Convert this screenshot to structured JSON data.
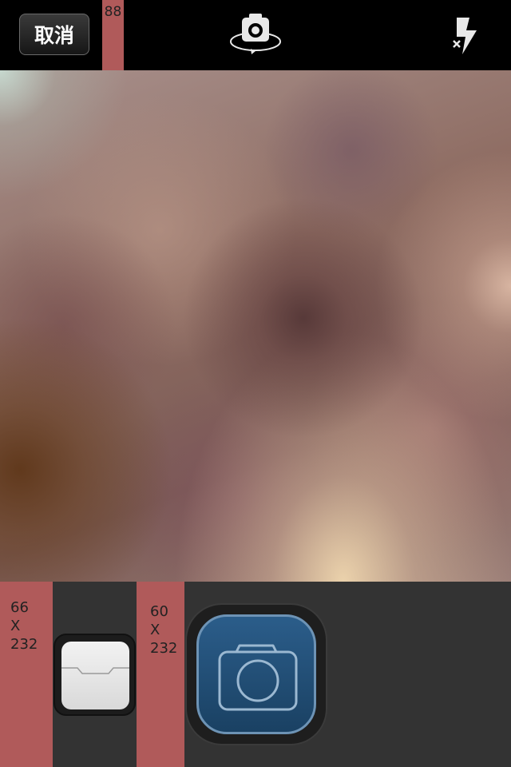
{
  "topbar": {
    "cancel_label": "取消",
    "guide_label": "88",
    "switch_camera_icon": "camera-switch-icon",
    "flash_icon": "flash-off-icon"
  },
  "viewfinder": {
    "content": "blurred-camera-preview"
  },
  "bottombar": {
    "guide_left": {
      "line1": "66",
      "line2": "X",
      "line3": "232"
    },
    "guide_mid": {
      "line1": "60",
      "line2": "X",
      "line3": "232"
    },
    "album_icon": "photo-album-icon",
    "shutter_icon": "camera-icon",
    "colors": {
      "guide": "#b05a5a",
      "shutter_fill": "#1f4b73",
      "shutter_outline": "#8fb2cf",
      "toolbar_bg": "#333333"
    }
  }
}
